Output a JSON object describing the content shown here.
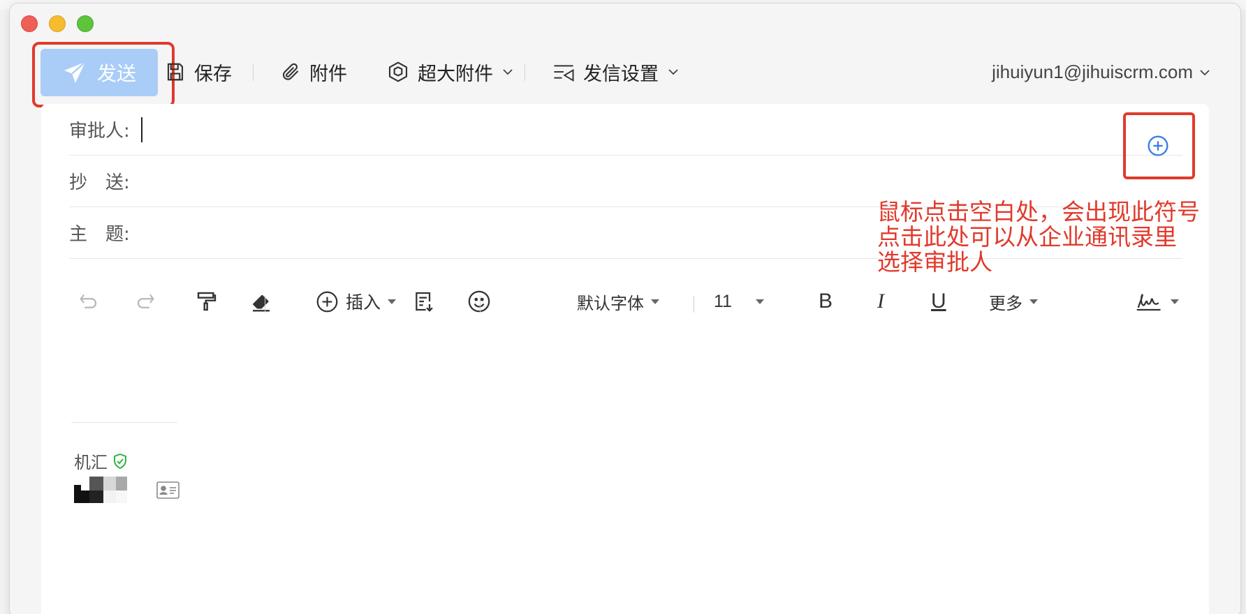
{
  "toolbar": {
    "send_label": "发送",
    "save_label": "保存",
    "attach_label": "附件",
    "big_attach_label": "超大附件",
    "send_settings_label": "发信设置",
    "account": "jihuiyun1@jihuiscrm.com"
  },
  "fields": {
    "approver_label": "审批人:",
    "cc_label": "抄　送:",
    "subject_label": "主　题:"
  },
  "annotation": {
    "line1": "鼠标点击空白处，会出现此符号",
    "line2": "点击此处可以从企业通讯录里",
    "line3": "选择审批人"
  },
  "format_bar": {
    "insert_label": "插入",
    "font_family": "默认字体",
    "font_size": "11",
    "bold": "B",
    "italic": "I",
    "underline": "U",
    "more_label": "更多"
  },
  "signature": {
    "name": "机汇"
  },
  "colors": {
    "accent": "#3b7ee8",
    "send_disabled": "#a9cdf7",
    "annotation_red": "#e03a2c",
    "verified_green": "#2fb344"
  }
}
